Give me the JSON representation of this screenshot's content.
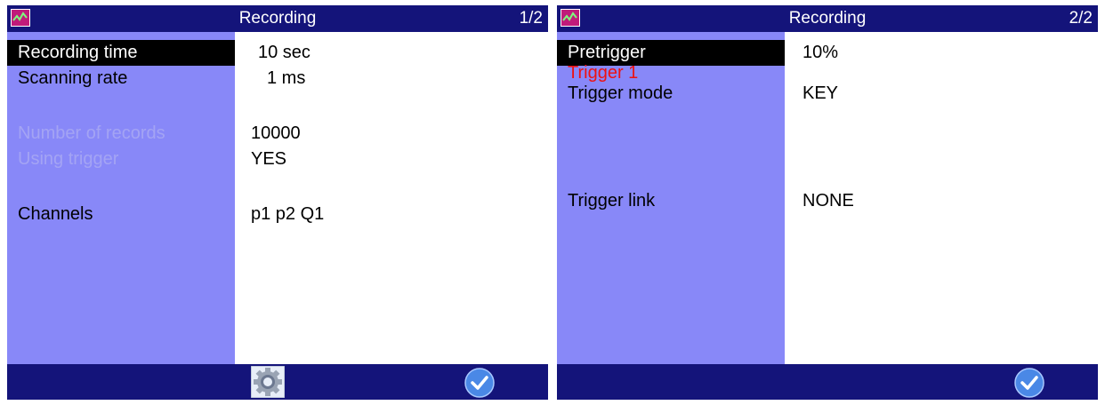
{
  "screen1": {
    "title": "Recording",
    "page": "1/2",
    "rows": [
      {
        "label": "Recording time",
        "value": "10 sec"
      },
      {
        "label": "Scanning rate",
        "value": "1 ms"
      },
      {
        "label": "Number of records",
        "value": "10000"
      },
      {
        "label": "Using trigger",
        "value": "YES"
      },
      {
        "label": "Channels",
        "value": "p1 p2 Q1"
      }
    ]
  },
  "screen2": {
    "title": "Recording",
    "page": "2/2",
    "rows": [
      {
        "label": "Pretrigger",
        "value": "10%"
      },
      {
        "label": "Trigger 1",
        "value": ""
      },
      {
        "label": "Trigger mode",
        "value": "KEY"
      },
      {
        "label": "Trigger link",
        "value": "NONE"
      }
    ]
  },
  "icons": {
    "app": "app-icon",
    "settings": "gear-icon",
    "confirm": "checkmark-icon"
  },
  "colors": {
    "bar": "#14147a",
    "label_column": "#8888f8",
    "selected_row": "#000000",
    "disabled_text": "#a4a4f4",
    "trigger_header": "#ee1111"
  }
}
